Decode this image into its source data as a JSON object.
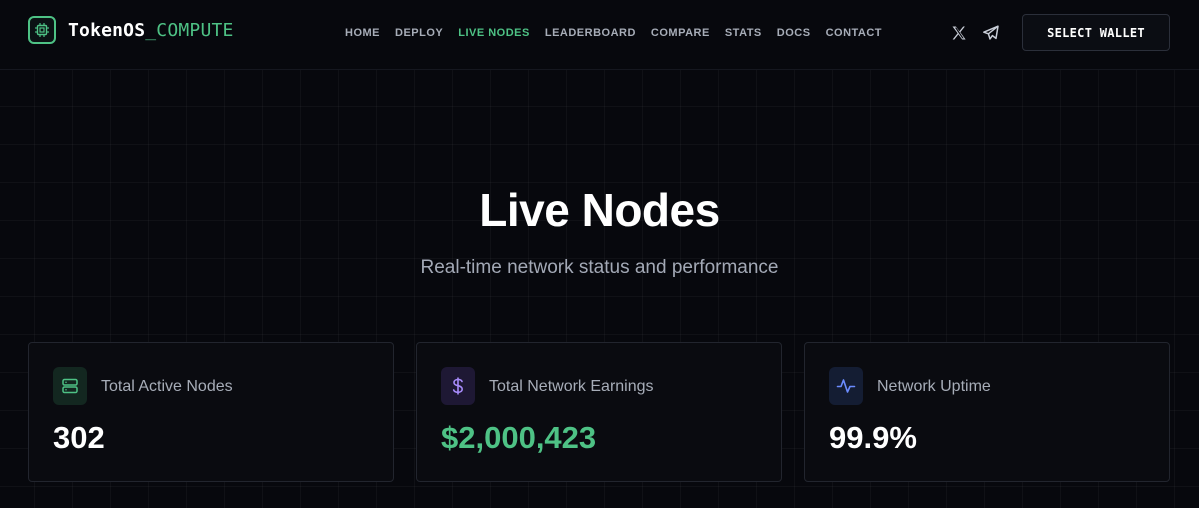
{
  "brand": {
    "name_main": "TokenOS",
    "name_accent": "_COMPUTE",
    "logo_icon": "cpu-chip-icon",
    "accent_color": "#4ec285"
  },
  "nav": {
    "items": [
      {
        "label": "HOME",
        "active": false
      },
      {
        "label": "DEPLOY",
        "active": false
      },
      {
        "label": "LIVE NODES",
        "active": true
      },
      {
        "label": "LEADERBOARD",
        "active": false
      },
      {
        "label": "COMPARE",
        "active": false
      },
      {
        "label": "STATS",
        "active": false
      },
      {
        "label": "DOCS",
        "active": false
      },
      {
        "label": "CONTACT",
        "active": false
      }
    ]
  },
  "social": {
    "x_icon": "x-twitter-icon",
    "telegram_icon": "telegram-icon"
  },
  "header": {
    "wallet_button": "SELECT WALLET"
  },
  "hero": {
    "title": "Live Nodes",
    "subtitle": "Real-time network status and performance"
  },
  "stats": [
    {
      "label": "Total Active Nodes",
      "value": "302",
      "icon": "server-icon",
      "value_color": "#ffffff"
    },
    {
      "label": "Total Network Earnings",
      "value": "$2,000,423",
      "icon": "dollar-icon",
      "value_color": "#4ec285"
    },
    {
      "label": "Network Uptime",
      "value": "99.9%",
      "icon": "activity-icon",
      "value_color": "#ffffff"
    }
  ]
}
